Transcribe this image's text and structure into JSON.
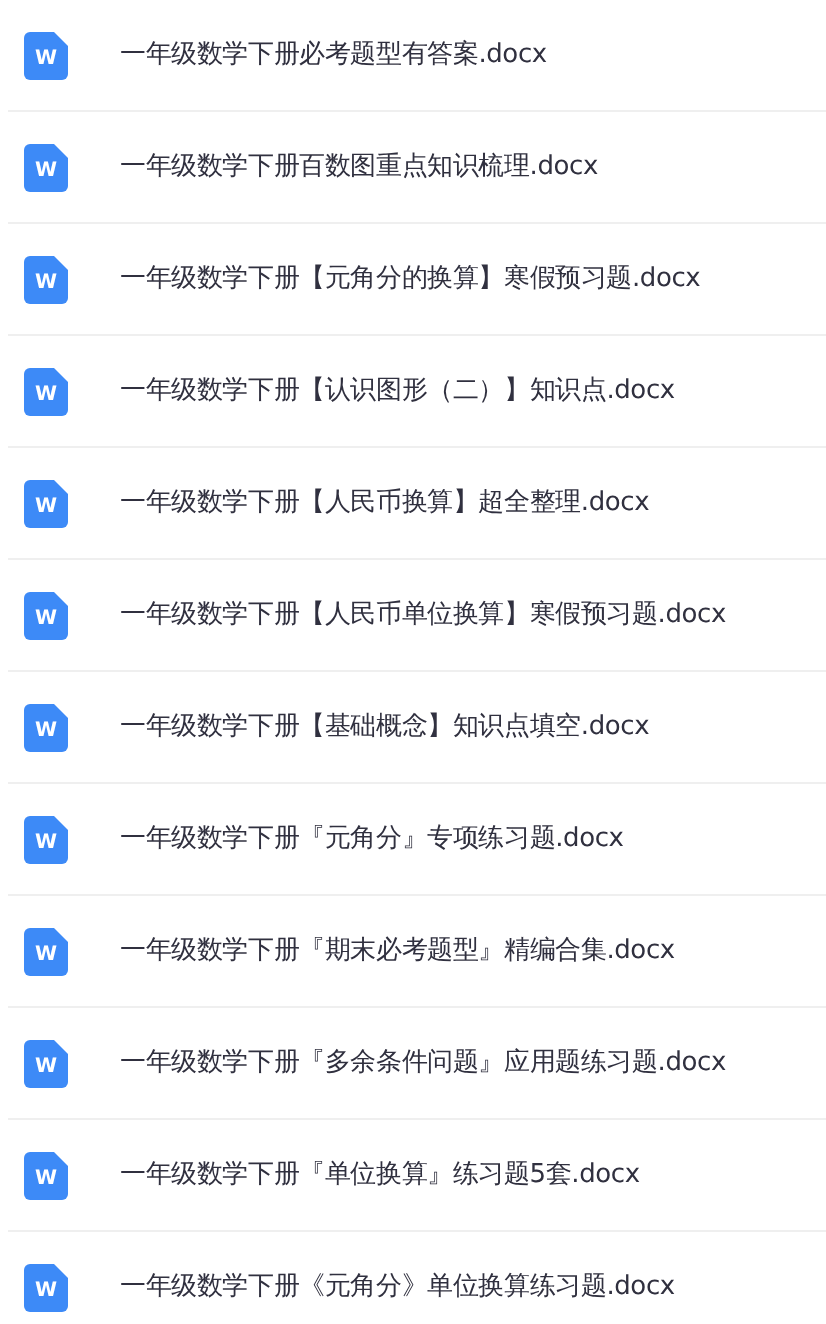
{
  "files": [
    {
      "icon_letter": "W",
      "name": "一年级数学下册必考题型有答案.docx"
    },
    {
      "icon_letter": "W",
      "name": "一年级数学下册百数图重点知识梳理.docx"
    },
    {
      "icon_letter": "W",
      "name": "一年级数学下册【元角分的换算】寒假预习题.docx"
    },
    {
      "icon_letter": "W",
      "name": "一年级数学下册【认识图形（二）】知识点.docx"
    },
    {
      "icon_letter": "W",
      "name": "一年级数学下册【人民币换算】超全整理.docx"
    },
    {
      "icon_letter": "W",
      "name": "一年级数学下册【人民币单位换算】寒假预习题.docx"
    },
    {
      "icon_letter": "W",
      "name": "一年级数学下册【基础概念】知识点填空.docx"
    },
    {
      "icon_letter": "W",
      "name": "一年级数学下册『元角分』专项练习题.docx"
    },
    {
      "icon_letter": "W",
      "name": "一年级数学下册『期末必考题型』精编合集.docx"
    },
    {
      "icon_letter": "W",
      "name": "一年级数学下册『多余条件问题』应用题练习题.docx"
    },
    {
      "icon_letter": "W",
      "name": "一年级数学下册『单位换算』练习题5套.docx"
    },
    {
      "icon_letter": "W",
      "name": "一年级数学下册《元角分》单位换算练习题.docx"
    }
  ]
}
